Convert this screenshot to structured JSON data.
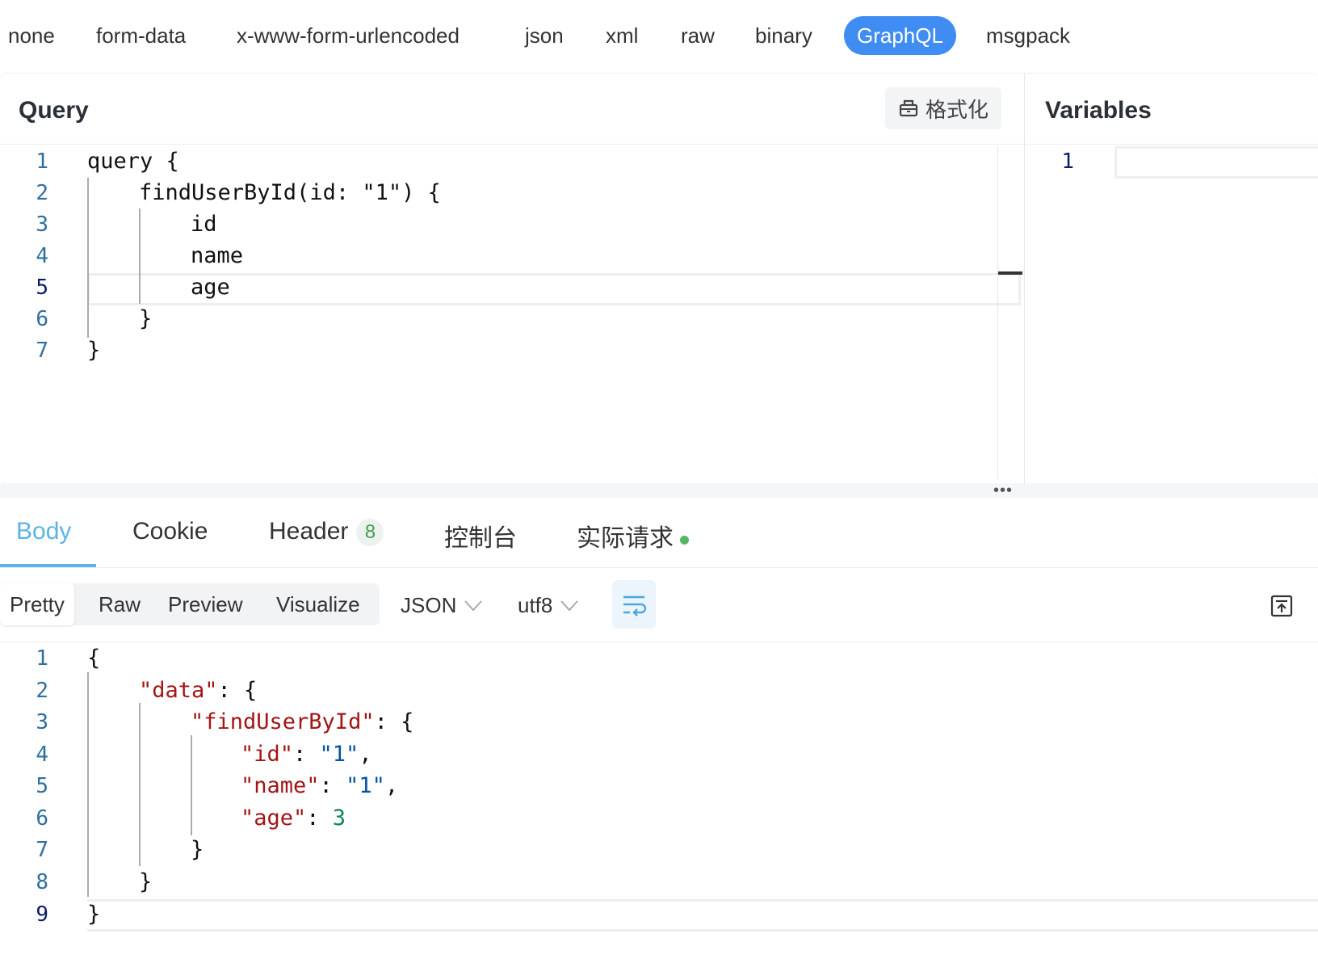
{
  "body_types": [
    "none",
    "form-data",
    "x-www-form-urlencoded",
    "json",
    "xml",
    "raw",
    "binary",
    "GraphQL",
    "msgpack"
  ],
  "body_type_active": "GraphQL",
  "query": {
    "title": "Query",
    "format_label": "格式化",
    "lines": [
      "query {",
      "findUserById(id: \"1\") {",
      "id",
      "name",
      "age",
      "}",
      "}"
    ],
    "line_numbers": [
      "1",
      "2",
      "3",
      "4",
      "5",
      "6",
      "7"
    ],
    "current_line": "5"
  },
  "variables": {
    "title": "Variables",
    "line_numbers": [
      "1"
    ]
  },
  "response_tabs": {
    "body": "Body",
    "cookie": "Cookie",
    "header": "Header",
    "header_count": "8",
    "console": "控制台",
    "actual_request": "实际请求"
  },
  "view_modes": [
    "Pretty",
    "Raw",
    "Preview",
    "Visualize"
  ],
  "view_mode_active": "Pretty",
  "format_select": "JSON",
  "encoding_select": "utf8",
  "response": {
    "line_numbers": [
      "1",
      "2",
      "3",
      "4",
      "5",
      "6",
      "7",
      "8",
      "9"
    ],
    "current_line": "9",
    "t": {
      "open": "{",
      "data_key": "\"data\"",
      "colon_brace": ": {",
      "find_key": "\"findUserById\"",
      "id_key": "\"id\"",
      "colon": ": ",
      "id_val": "\"1\"",
      "comma": ",",
      "name_key": "\"name\"",
      "name_val": "\"1\"",
      "age_key": "\"age\"",
      "age_val": "3",
      "close": "}"
    }
  },
  "colors": {
    "accent": "#3f8cf3",
    "tab_active": "#5bb4e3",
    "json_key": "#a31515",
    "json_string": "#0451a5",
    "json_number": "#098658",
    "badge": "#3fa24f"
  }
}
